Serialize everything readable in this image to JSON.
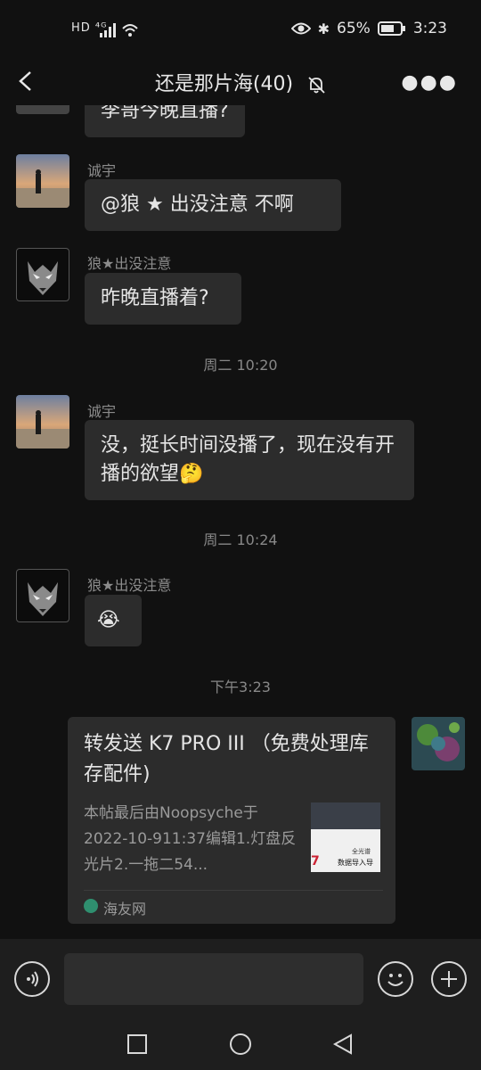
{
  "status": {
    "left": "HD ⁴ᴳ",
    "battery": "65%",
    "time": "3:23"
  },
  "header": {
    "title": "还是那片海(40)"
  },
  "messages": {
    "partial_text": "李哥今晚直播?",
    "m1_sender": "诚宇",
    "m1_text": "@狼 ★ 出没注意  不啊",
    "m2_sender": "狼★出没注意",
    "m2_text": "昨晚直播着?",
    "time1": "周二 10:20",
    "m3_sender": "诚宇",
    "m3_text": "没，挺长时间没播了，现在没有开播的欲望🤔",
    "time2": "周二 10:24",
    "m4_sender": "狼★出没注意",
    "m4_text": "😭",
    "time3": "下午3:23"
  },
  "card": {
    "title": "转发送 K7 PRO III （免费处理库存配件)",
    "desc": "本帖最后由Noopsyche于2022-10-911:37编辑1.灯盘反光片2.一拖二54...",
    "source": "海友网",
    "thumb_text1": "全光谱",
    "thumb_text2": "数据导入导"
  },
  "icons": {
    "back": "back-chevron-icon",
    "mute": "bell-off-icon",
    "more": "more-dots-icon",
    "voice": "voice-icon",
    "emoji": "emoji-icon",
    "add": "plus-icon"
  }
}
